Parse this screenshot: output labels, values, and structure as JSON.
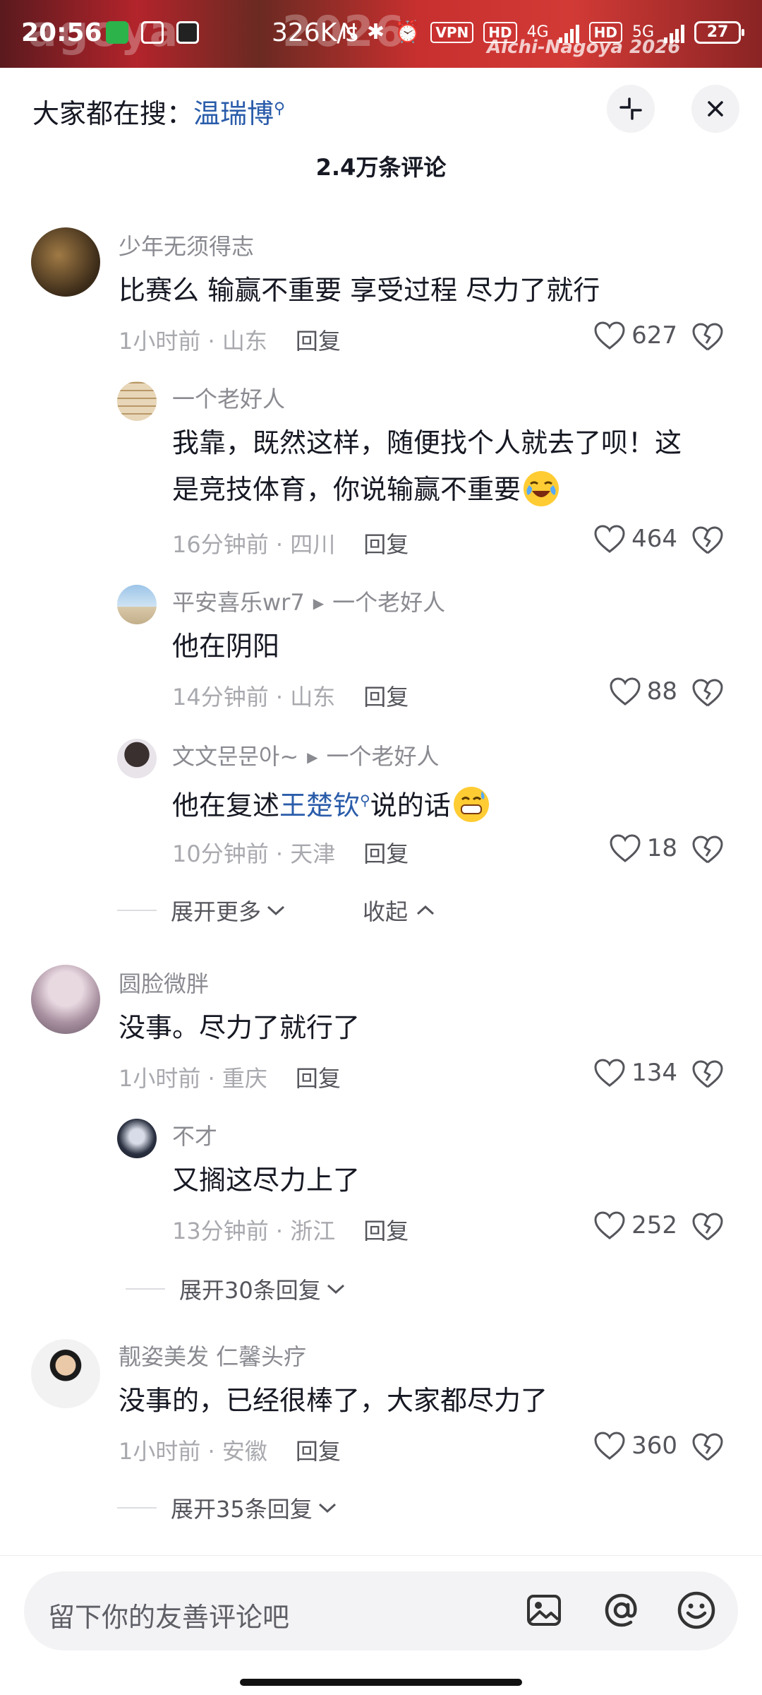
{
  "status_bar": {
    "time": "20:56",
    "net_speed": "326K/s",
    "bg_text_left": "agoya",
    "bg_text_mid": "2026",
    "bg_text_small": "Aichi-Nagoya 2026",
    "vpn": "VPN",
    "hd": "HD",
    "net4g": "4G",
    "net5g": "5G",
    "battery": "27"
  },
  "header": {
    "search_prefix": "大家都在搜：",
    "search_keyword": "温瑞博",
    "comment_count": "2.4万条评论"
  },
  "comments": [
    {
      "user": "少年无须得志",
      "text": "比赛么 输赢不重要 享受过程 尽力了就行",
      "time": "1小时前",
      "location": "山东",
      "reply": "回复",
      "likes": "627"
    },
    {
      "user": "一个老好人",
      "text_line1": "我靠，既然这样，随便找个人就去了呗！这",
      "text_line2": "是竞技体育，你说输赢不重要",
      "time": "16分钟前",
      "location": "四川",
      "reply": "回复",
      "likes": "464"
    },
    {
      "user": "平安喜乐wr7",
      "reply_to": "一个老好人",
      "text": "他在阴阳",
      "time": "14分钟前",
      "location": "山东",
      "reply": "回复",
      "likes": "88"
    },
    {
      "user": "文文문문아~",
      "reply_to": "一个老好人",
      "text_before": "他在复述",
      "text_link": "王楚钦",
      "text_after": "说的话",
      "time": "10分钟前",
      "location": "天津",
      "reply": "回复",
      "likes": "18"
    },
    {
      "user": "圆脸微胖",
      "text": "没事。尽力了就行了",
      "time": "1小时前",
      "location": "重庆",
      "reply": "回复",
      "likes": "134"
    },
    {
      "user": "不才",
      "text": "又搁这尽力上了",
      "time": "13分钟前",
      "location": "浙江",
      "reply": "回复",
      "likes": "252"
    },
    {
      "user": "靓姿美发  仁馨头疗",
      "text": "没事的，已经很棒了，大家都尽力了",
      "time": "1小时前",
      "location": "安徽",
      "reply": "回复",
      "likes": "360"
    }
  ],
  "expand": {
    "more": "展开更多",
    "collapse": "收起",
    "expand_30": "展开30条回复",
    "expand_35": "展开35条回复"
  },
  "input": {
    "placeholder": "留下你的友善评论吧"
  },
  "colors": {
    "link": "#2a5caa",
    "muted": "#a8a9ae",
    "text": "#161823"
  }
}
